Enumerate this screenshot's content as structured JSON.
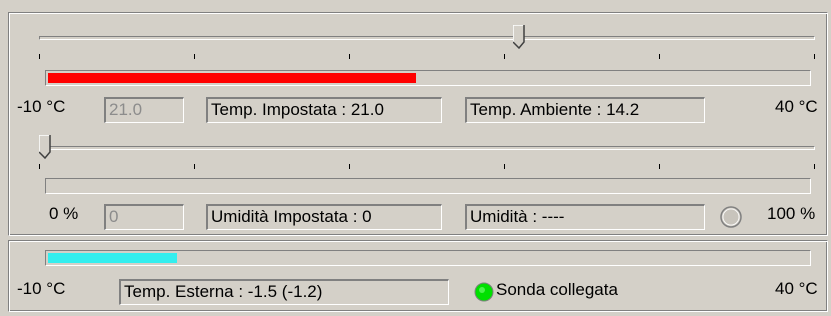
{
  "temperature": {
    "min_label": "-10 °C",
    "max_label": "40 °C",
    "slider_value": 21.0,
    "progress_value": 14.2,
    "range_min": -10,
    "range_max": 40,
    "input_value": "21.0",
    "set_label": "Temp. Impostata : 21.0",
    "ambient_label": "Temp. Ambiente : 14.2",
    "bar_color": "#ff0000"
  },
  "humidity": {
    "min_label": "0 %",
    "max_label": "100 %",
    "slider_value": 0,
    "input_value": "0",
    "set_label": "Umidità Impostata :   0",
    "current_label": "Umidità : ----",
    "indicator_color": "#a0a0a0"
  },
  "external": {
    "min_label": "-10 °C",
    "max_label": "40 °C",
    "progress_value": -1.5,
    "range_min": -10,
    "range_max": 40,
    "temp_label": "Temp. Esterna : -1.5 (-1.2)",
    "probe_label": "Sonda collegata",
    "probe_color": "#00e000",
    "bar_color": "#33eeee"
  }
}
